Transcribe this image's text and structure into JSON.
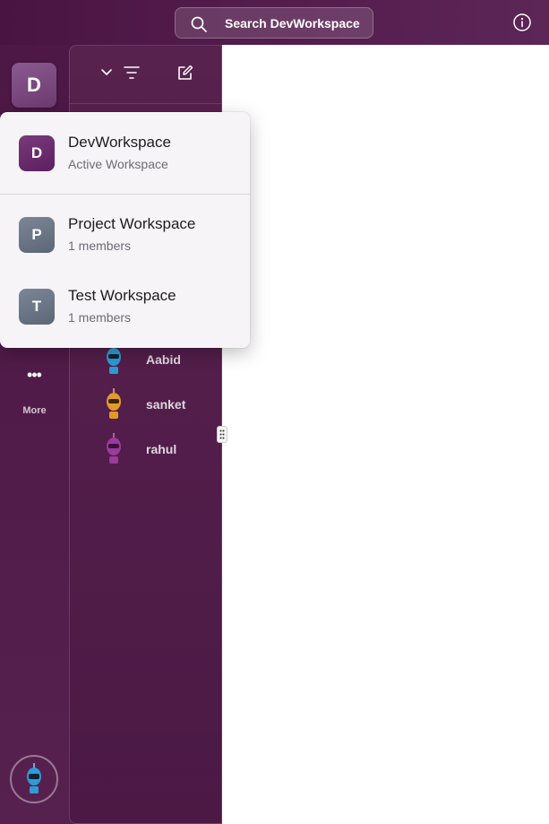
{
  "search": {
    "label": "Search DevWorkspace"
  },
  "rail": {
    "workspace_initial": "D",
    "more_label": "More"
  },
  "dms": [
    {
      "name": "Aabid",
      "color": "#2f9ad6"
    },
    {
      "name": "sanket",
      "color": "#e49a2a"
    },
    {
      "name": "rahul",
      "color": "#9a3a9a"
    }
  ],
  "popup": {
    "items": [
      {
        "initial": "D",
        "title": "DevWorkspace",
        "subtitle": "Active Workspace",
        "color": "#6b2d6c"
      },
      {
        "initial": "P",
        "title": "Project Workspace",
        "subtitle": "1 members",
        "color": "#6c7788"
      },
      {
        "initial": "T",
        "title": "Test Workspace",
        "subtitle": "1 members",
        "color": "#6c7788"
      }
    ]
  },
  "icons": [
    "search-icon",
    "info-icon",
    "chevron-down-icon",
    "filter-icon",
    "compose-icon",
    "more-icon",
    "drag-handle-icon"
  ]
}
